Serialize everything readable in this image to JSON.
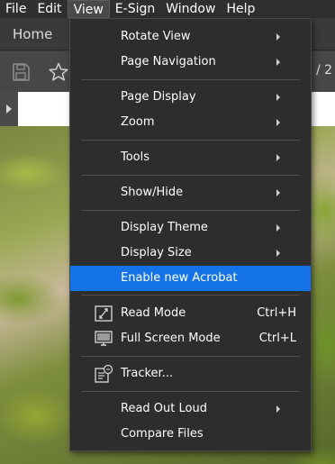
{
  "menubar": {
    "items": [
      {
        "label": "File"
      },
      {
        "label": "Edit"
      },
      {
        "label": "View"
      },
      {
        "label": "E-Sign"
      },
      {
        "label": "Window"
      },
      {
        "label": "Help"
      }
    ]
  },
  "tabs": {
    "home_label": "Home"
  },
  "toolbar": {
    "page_indicator": "/ 2"
  },
  "view_menu": {
    "items": [
      {
        "label": "Rotate View",
        "submenu": true
      },
      {
        "label": "Page Navigation",
        "submenu": true
      },
      {
        "label": "Page Display",
        "submenu": true
      },
      {
        "label": "Zoom",
        "submenu": true
      },
      {
        "label": "Tools",
        "submenu": true
      },
      {
        "label": "Show/Hide",
        "submenu": true
      },
      {
        "label": "Display Theme",
        "submenu": true
      },
      {
        "label": "Display Size",
        "submenu": true
      },
      {
        "label": "Enable new Acrobat",
        "highlighted": true
      },
      {
        "label": "Read Mode",
        "shortcut": "Ctrl+H",
        "icon": "read-mode-icon"
      },
      {
        "label": "Full Screen Mode",
        "shortcut": "Ctrl+L",
        "icon": "full-screen-icon"
      },
      {
        "label": "Tracker...",
        "icon": "tracker-icon"
      },
      {
        "label": "Read Out Loud",
        "submenu": true
      },
      {
        "label": "Compare Files"
      }
    ]
  },
  "colors": {
    "highlight": "#1473e6",
    "menu_background": "#2d2d2d",
    "menubar_background": "#2f2f2f"
  }
}
